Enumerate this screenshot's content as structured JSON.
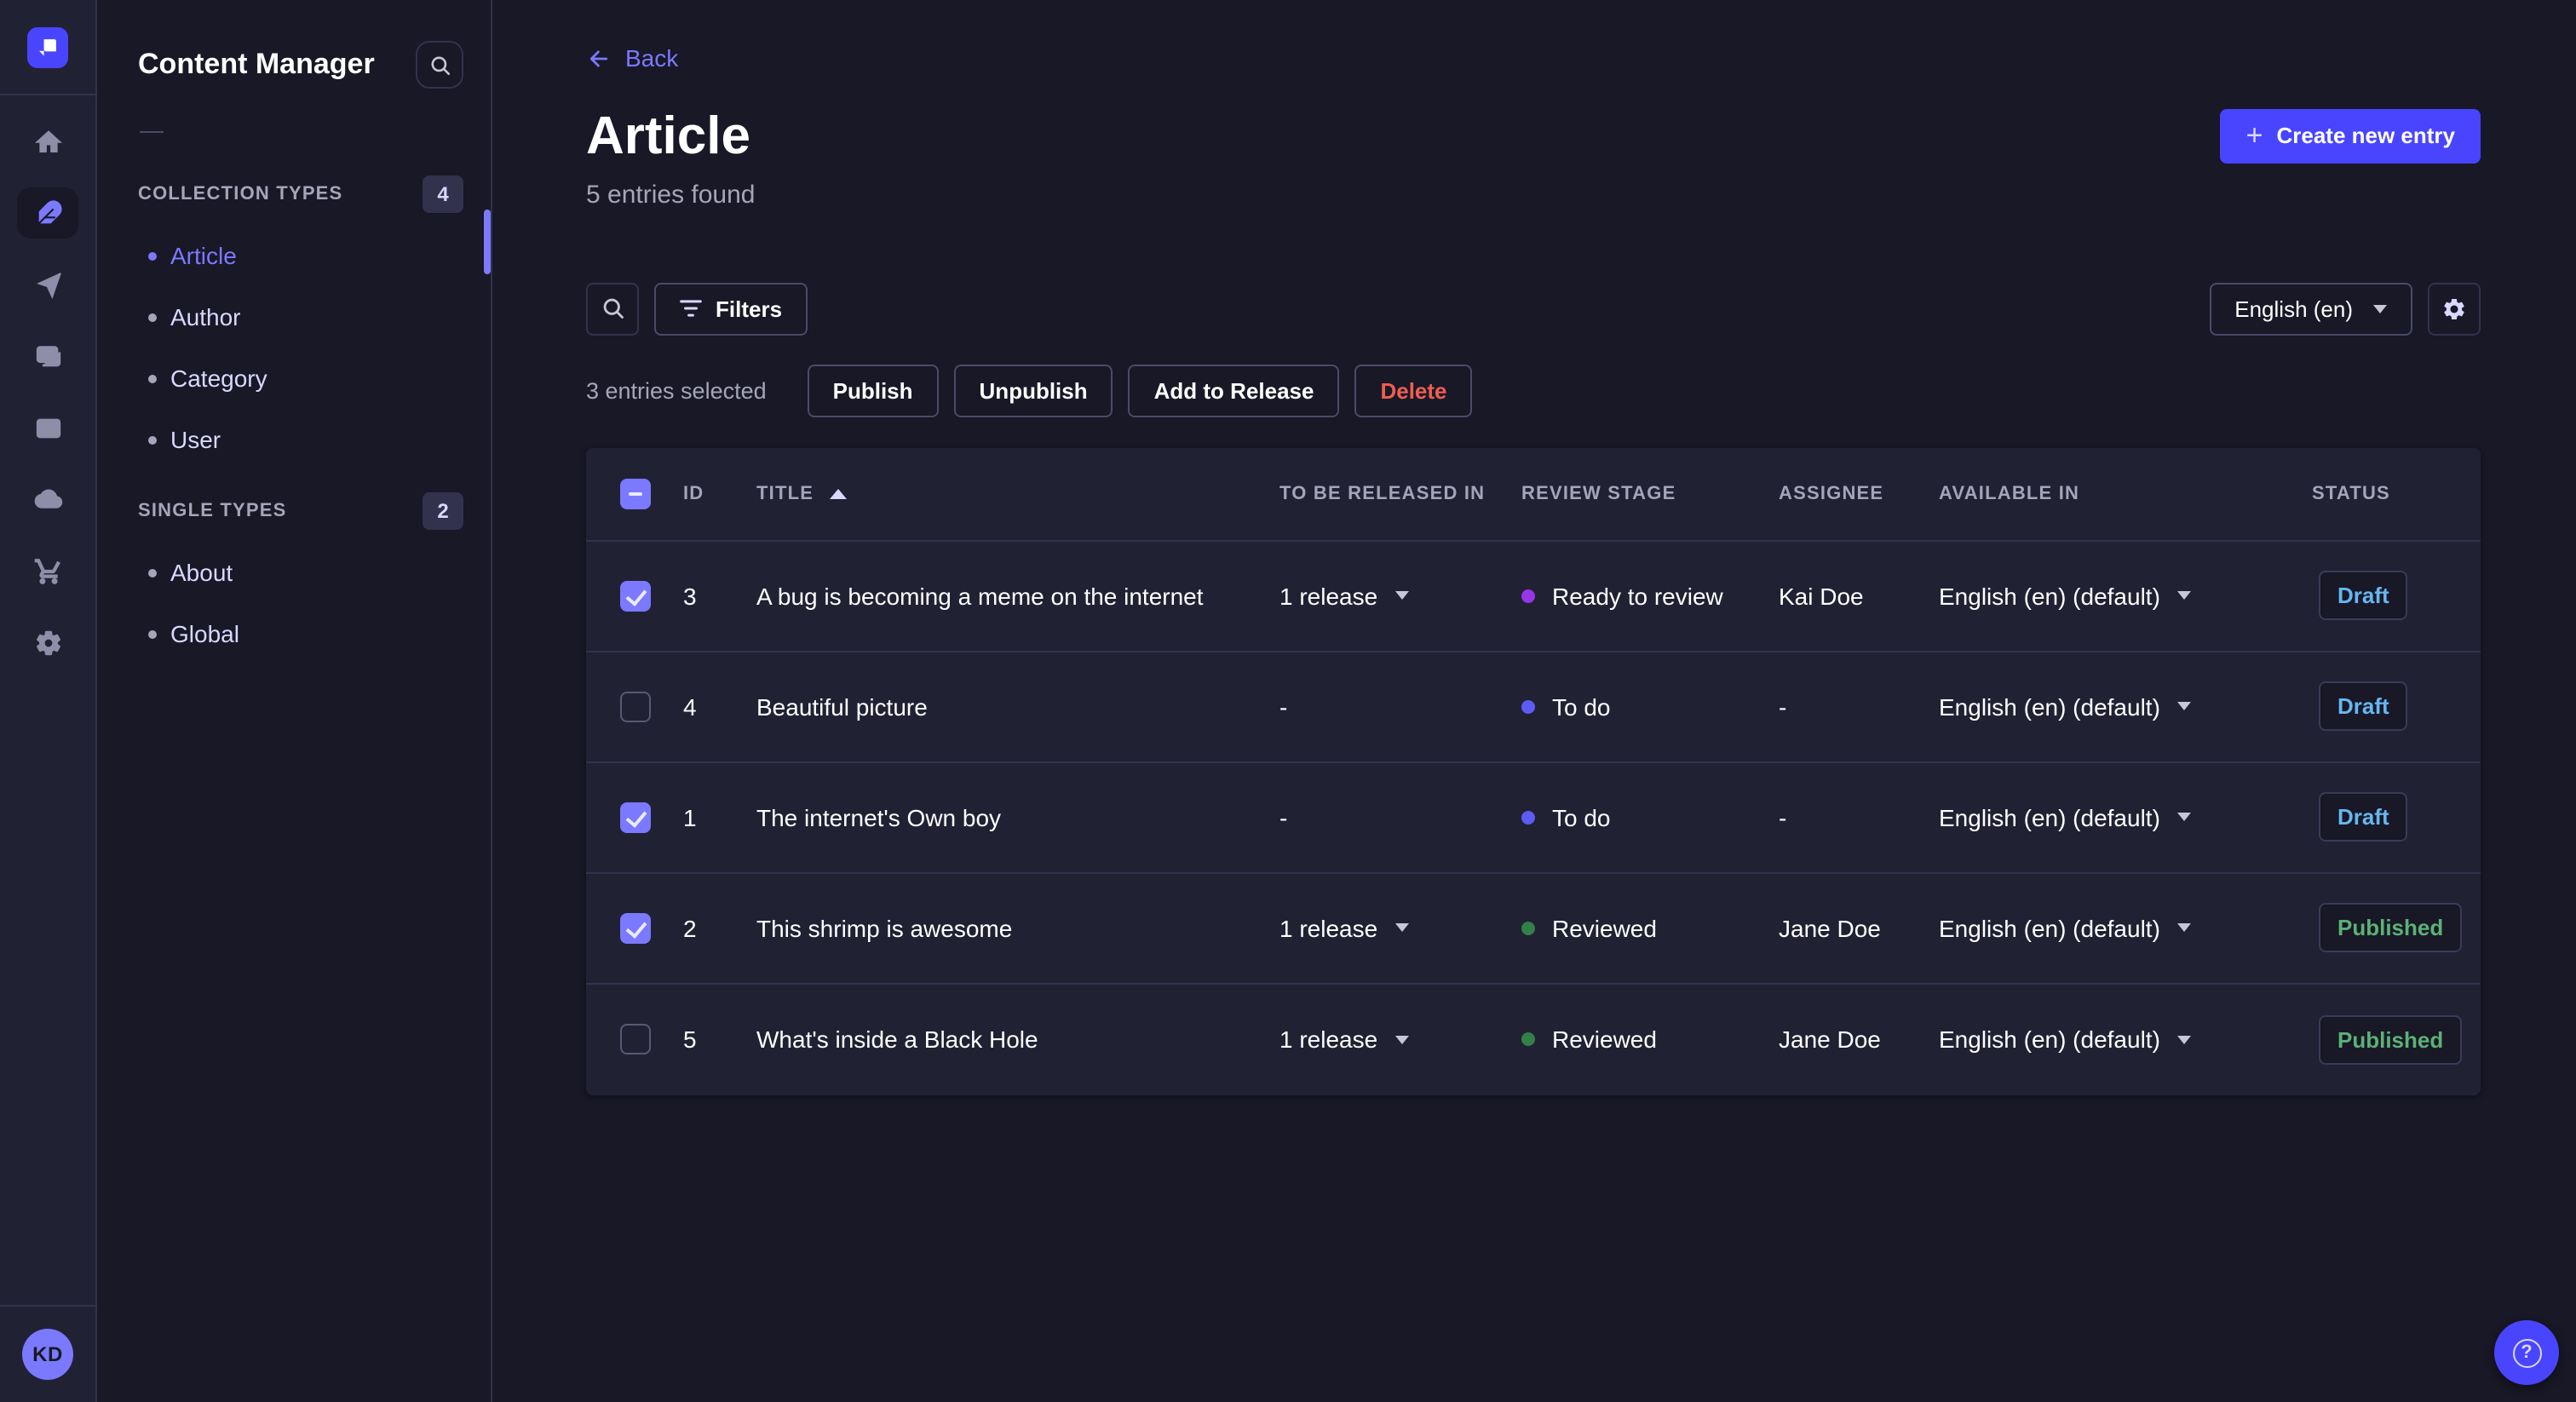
{
  "nav": {
    "avatar_initials": "KD",
    "icons": [
      "home",
      "content-manager",
      "releases",
      "media-library",
      "content-type-builder",
      "deploy",
      "marketplace",
      "settings"
    ],
    "active_icon": "content-manager"
  },
  "subnav": {
    "title": "Content Manager",
    "sections": [
      {
        "label": "COLLECTION TYPES",
        "badge": "4",
        "items": [
          {
            "label": "Article",
            "active": true
          },
          {
            "label": "Author"
          },
          {
            "label": "Category"
          },
          {
            "label": "User"
          }
        ]
      },
      {
        "label": "SINGLE TYPES",
        "badge": "2",
        "items": [
          {
            "label": "About"
          },
          {
            "label": "Global"
          }
        ]
      }
    ]
  },
  "header": {
    "back_label": "Back",
    "title": "Article",
    "subtitle": "5 entries found",
    "create_label": "Create new entry",
    "create_plus": "+"
  },
  "toolbar": {
    "filters_label": "Filters",
    "locale_value": "English (en)"
  },
  "selection": {
    "summary": "3 entries selected",
    "publish": "Publish",
    "unpublish": "Unpublish",
    "add_to_release": "Add to Release",
    "delete": "Delete"
  },
  "table": {
    "headers": [
      "ID",
      "TITLE",
      "TO BE RELEASED IN",
      "REVIEW STAGE",
      "ASSIGNEE",
      "AVAILABLE IN",
      "STATUS"
    ],
    "sort": {
      "column": "TITLE",
      "direction": "asc"
    },
    "rows": [
      {
        "checked": true,
        "id": "3",
        "title": "A bug is becoming a meme on the internet",
        "release": "1 release",
        "has_release": true,
        "stage": "Ready to review",
        "stage_color": "#9736e8",
        "assignee": "Kai Doe",
        "locale": "English (en) (default)",
        "status": "Draft",
        "status_color": "#66b7f1"
      },
      {
        "checked": false,
        "id": "4",
        "title": "Beautiful picture",
        "release": "-",
        "has_release": false,
        "stage": "To do",
        "stage_color": "#5c5cf5",
        "assignee": "-",
        "locale": "English (en) (default)",
        "status": "Draft",
        "status_color": "#66b7f1"
      },
      {
        "checked": true,
        "id": "1",
        "title": "The internet's Own boy",
        "release": "-",
        "has_release": false,
        "stage": "To do",
        "stage_color": "#5c5cf5",
        "assignee": "-",
        "locale": "English (en) (default)",
        "status": "Draft",
        "status_color": "#66b7f1"
      },
      {
        "checked": true,
        "id": "2",
        "title": "This shrimp is awesome",
        "release": "1 release",
        "has_release": true,
        "stage": "Reviewed",
        "stage_color": "#328048",
        "assignee": "Jane Doe",
        "locale": "English (en) (default)",
        "status": "Published",
        "status_color": "#5cb176"
      },
      {
        "checked": false,
        "id": "5",
        "title": "What's inside a Black Hole",
        "release": "1 release",
        "has_release": true,
        "stage": "Reviewed",
        "stage_color": "#328048",
        "assignee": "Jane Doe",
        "locale": "English (en) (default)",
        "status": "Published",
        "status_color": "#5cb176"
      }
    ]
  },
  "floating": {
    "help_glyph": "?"
  },
  "colors": {
    "primary": "#4945ff",
    "primary_light": "#7b79ff",
    "page_bg": "#181826",
    "panel_bg": "#212134",
    "border": "#32324d",
    "border_light": "#4a4a6a",
    "text_secondary": "#a5a5ba",
    "danger": "#ee5e52",
    "draft": "#66b7f1",
    "published": "#5cb176"
  }
}
